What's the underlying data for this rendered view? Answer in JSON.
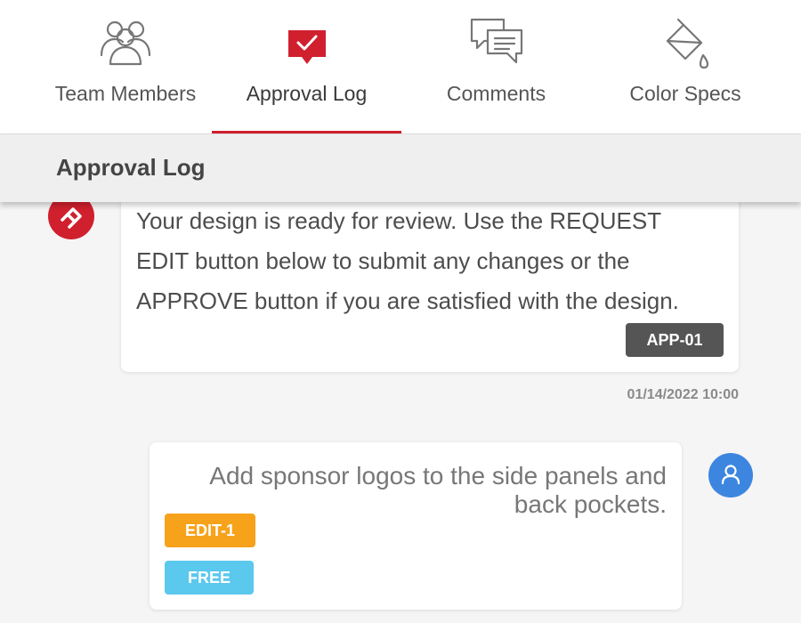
{
  "tabs": [
    {
      "label": "Team Members",
      "icon": "team-members-icon",
      "active": false
    },
    {
      "label": "Approval Log",
      "icon": "approval-log-icon",
      "active": true
    },
    {
      "label": "Comments",
      "icon": "comments-icon",
      "active": false
    },
    {
      "label": "Color Specs",
      "icon": "paint-bucket-icon",
      "active": false
    }
  ],
  "section": {
    "title": "Approval Log"
  },
  "messages": [
    {
      "text": "Your design is ready for review. Use the REQUEST EDIT button below to submit any changes or the APPROVE button if you are satisfied with the design.",
      "badge": "APP-01",
      "timestamp": "01/14/2022 10:00",
      "avatar_icon": "brand-logo-icon"
    },
    {
      "text": "Add sponsor logos to the side panels and back pockets.",
      "badges": [
        "EDIT-1",
        "FREE"
      ],
      "avatar_icon": "user-icon"
    }
  ],
  "colors": {
    "accent": "#d0202e",
    "badge_dark": "#555555",
    "badge_orange": "#f7a21b",
    "badge_blue": "#5bc8ee",
    "user_avatar": "#3d86e0"
  }
}
